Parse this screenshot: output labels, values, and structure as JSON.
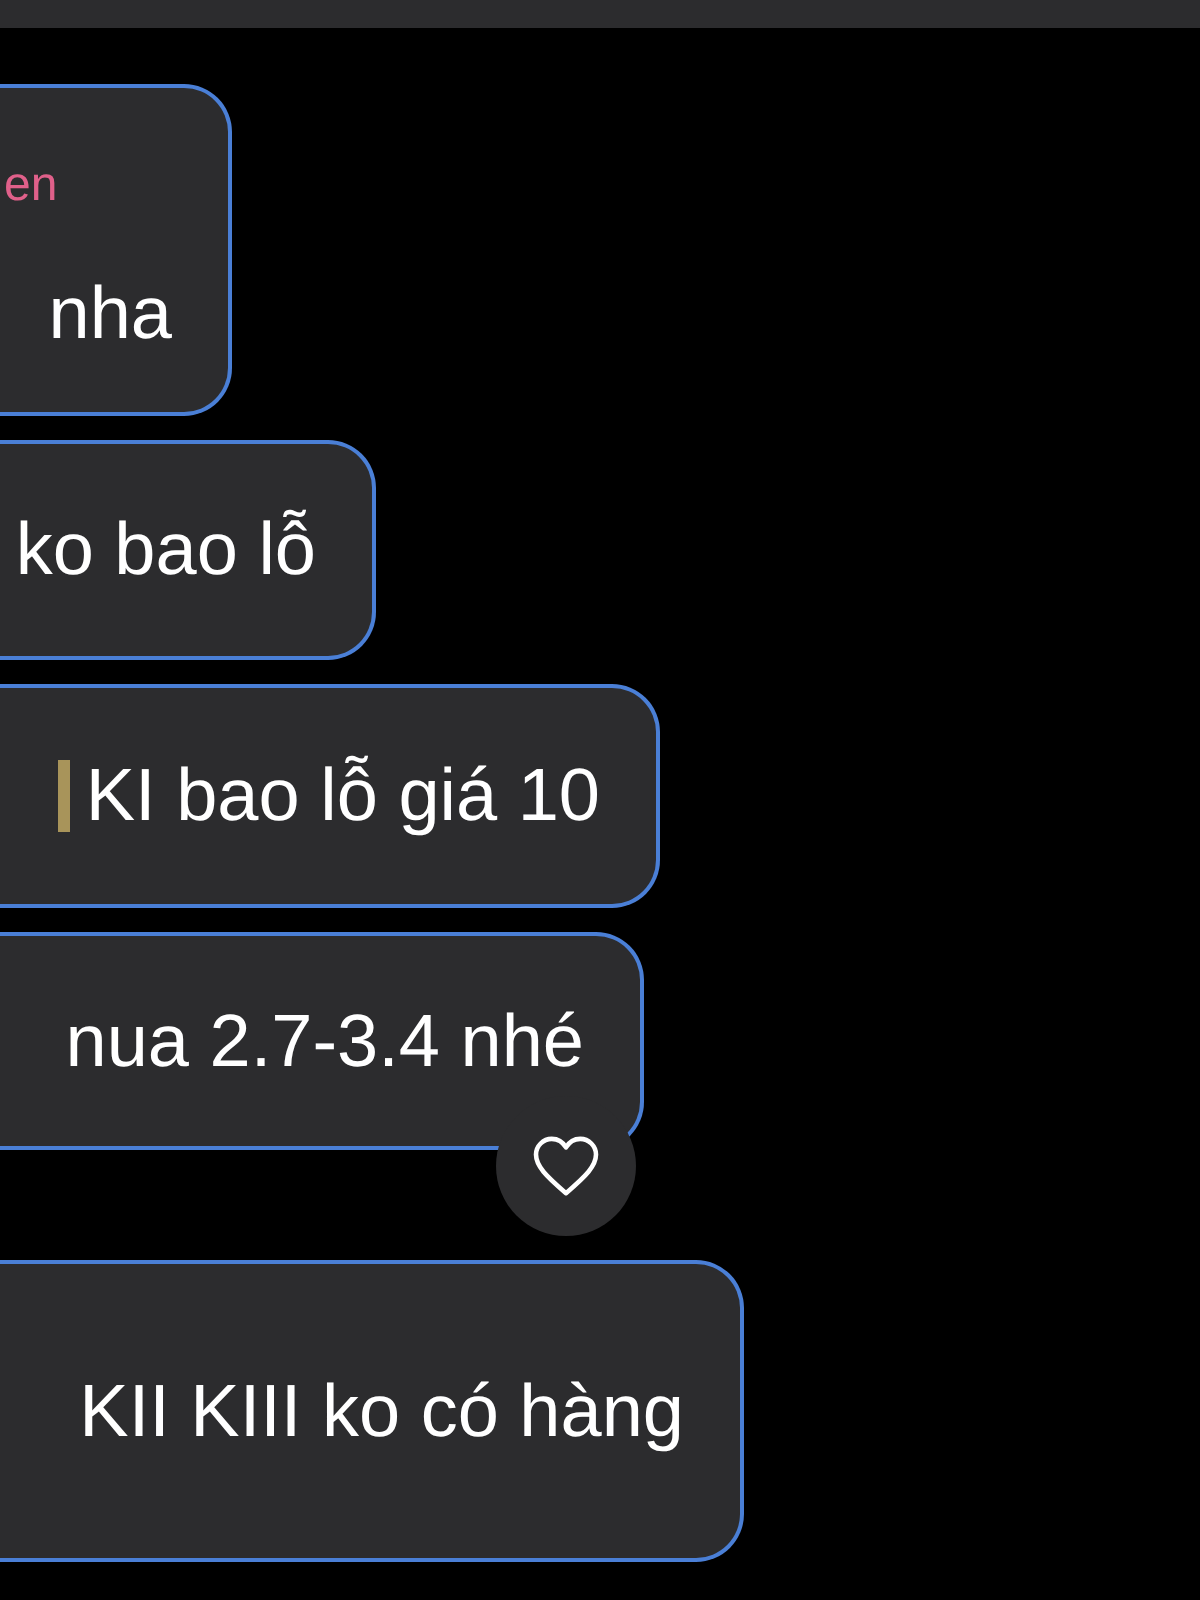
{
  "messages": [
    {
      "sender": "en",
      "text": "nha",
      "emoji": false,
      "reaction": false
    },
    {
      "text": "ko bao lỗ",
      "emoji": false,
      "reaction": false
    },
    {
      "text": "KI bao lỗ giá 10",
      "emoji": true,
      "reaction": false
    },
    {
      "text": "nua 2.7-3.4 nhé",
      "emoji": false,
      "reaction": true
    },
    {
      "text": "KII KIII ko có hàng",
      "emoji": false,
      "reaction": false
    }
  ]
}
